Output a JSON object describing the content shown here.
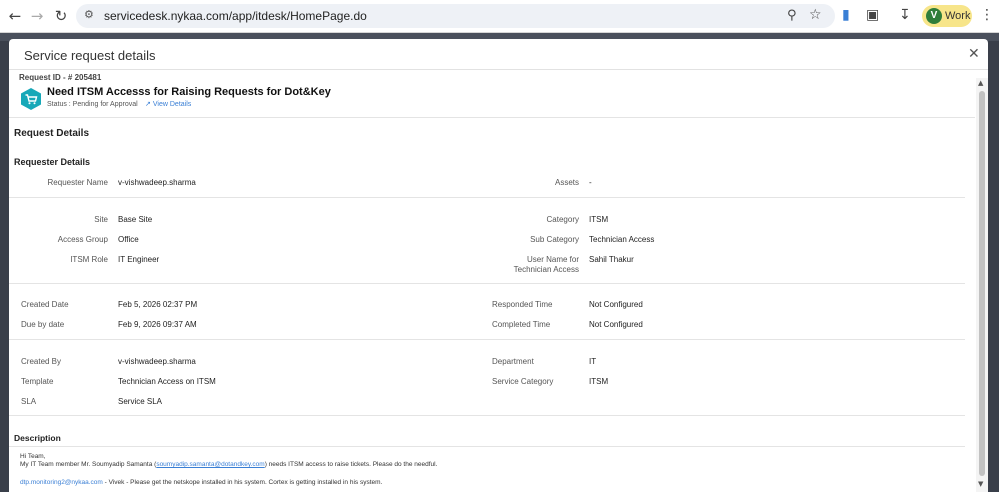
{
  "browser": {
    "url": "servicedesk.nykaa.com/app/itdesk/HomePage.do",
    "profile_initial": "V",
    "profile_label": "Work"
  },
  "modal": {
    "title": "Service request details",
    "request_id": "Request ID - # 205481",
    "request_title": "Need ITSM Accesss for Raising Requests for Dot&Key",
    "status": "Status : Pending for Approval",
    "view_details": "View Details",
    "request_details_heading": "Request Details",
    "requester_details_heading": "Requester Details",
    "requester": {
      "requester_name_label": "Requester Name",
      "requester_name": "v-vishwadeep.sharma",
      "assets_label": "Assets",
      "assets": "-"
    },
    "fields": {
      "site_label": "Site",
      "site": "Base Site",
      "category_label": "Category",
      "category": "ITSM",
      "access_group_label": "Access Group",
      "access_group": "Office",
      "sub_category_label": "Sub Category",
      "sub_category": "Technician Access",
      "itsm_role_label": "ITSM Role",
      "itsm_role": "IT Engineer",
      "user_name_label_1": "User Name for",
      "user_name_label_2": "Technician Access",
      "user_name": "Sahil Thakur"
    },
    "dates": {
      "created_date_label": "Created Date",
      "created_date": "Feb 5, 2026 02:37 PM",
      "responded_time_label": "Responded Time",
      "responded_time": "Not Configured",
      "due_by_label": "Due by date",
      "due_by": "Feb 9, 2026 09:37 AM",
      "completed_time_label": "Completed Time",
      "completed_time": "Not Configured"
    },
    "meta": {
      "created_by_label": "Created By",
      "created_by": "v-vishwadeep.sharma",
      "department_label": "Department",
      "department": "IT",
      "template_label": "Template",
      "template": "Technician Access on ITSM",
      "service_category_label": "Service Category",
      "service_category": "ITSM",
      "sla_label": "SLA",
      "sla": "Service SLA"
    },
    "description": {
      "heading": "Description",
      "line1": "Hi Team,",
      "line2_prefix": "My IT Team member Mr. Soumyadip Samanta (",
      "line2_email": "soumyadip.samanta@dotandkey.com",
      "line2_suffix": ") needs ITSM access to raise tickets. Please do the needful.",
      "line3_email": "dtp.monitoring2@nykaa.com",
      "line3_suffix": " - Vivek - Please get the netskope installed in his system. Cortex is getting installed in his system."
    }
  },
  "colors": {
    "accent": "#3a7fd5",
    "logo": "#17a8b8",
    "profile": "#f7e58a"
  }
}
